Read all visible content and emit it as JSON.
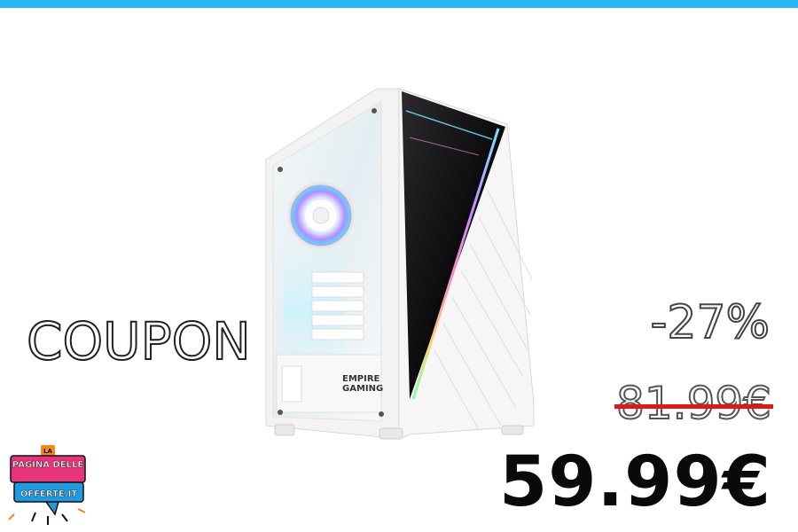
{
  "colors": {
    "top_bar": "#29b6f6",
    "strike": "#e01818",
    "logo_orange": "#f08a1c",
    "logo_pink": "#e8347c",
    "logo_blue": "#1e9be0"
  },
  "promo": {
    "coupon_label": "COUPON",
    "discount": "-27%",
    "old_price": "81.99€",
    "new_price": "59.99€"
  },
  "product": {
    "brand_line1": "EMPIRE",
    "brand_line2": "GAMING"
  },
  "logo": {
    "line1": "LA",
    "line2": "PAGINA DELLE",
    "line3": "OFFERTE.IT"
  },
  "icons": [
    "pc-case-image",
    "fan-icon",
    "site-logo"
  ]
}
